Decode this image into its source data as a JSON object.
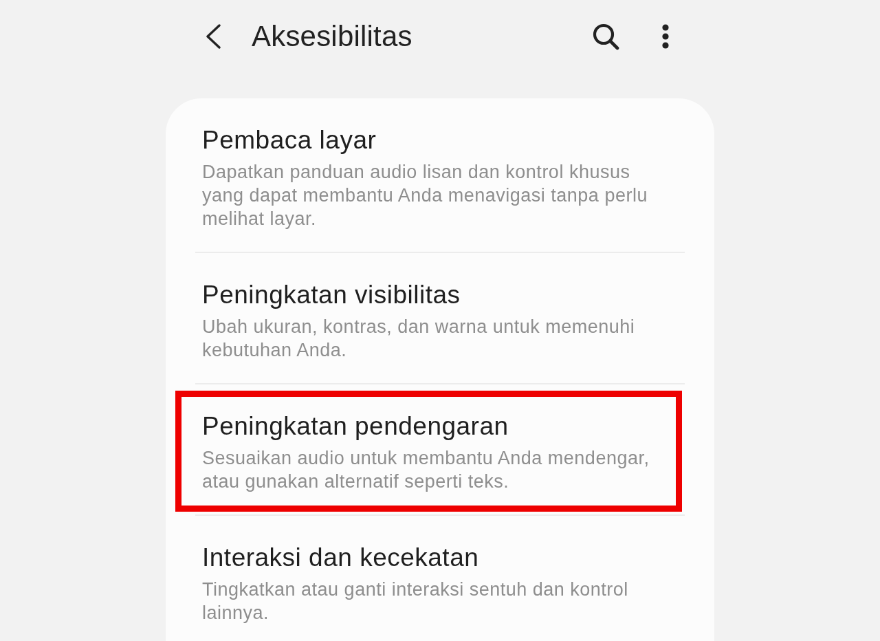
{
  "header": {
    "title": "Aksesibilitas"
  },
  "items": [
    {
      "title": "Pembaca layar",
      "description": "Dapatkan panduan audio lisan dan kontrol khusus yang dapat membantu Anda menavigasi tanpa perlu melihat layar.",
      "highlighted": false
    },
    {
      "title": "Peningkatan visibilitas",
      "description": "Ubah ukuran, kontras, dan warna untuk memenuhi kebutuhan Anda.",
      "highlighted": false
    },
    {
      "title": "Peningkatan pendengaran",
      "description": "Sesuaikan audio untuk membantu Anda mendengar, atau gunakan alternatif seperti teks.",
      "highlighted": true
    },
    {
      "title": "Interaksi dan kecekatan",
      "description": "Tingkatkan atau ganti interaksi sentuh dan kontrol lainnya.",
      "highlighted": false
    }
  ]
}
